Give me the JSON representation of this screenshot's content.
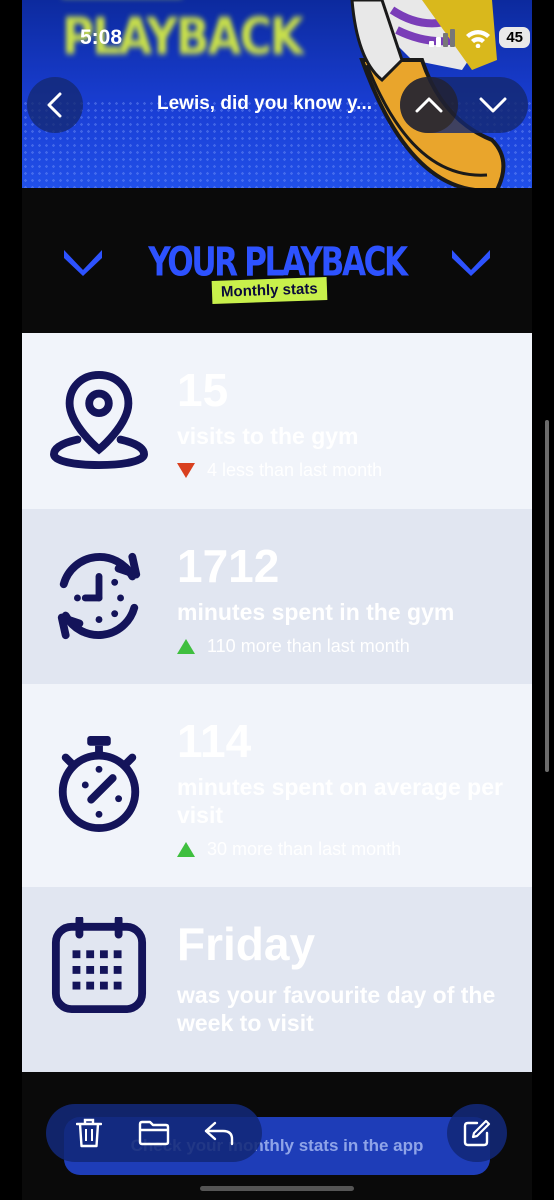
{
  "status_bar": {
    "time": "5:08",
    "battery": "45"
  },
  "nav": {
    "subject": "Lewis, did you know y..."
  },
  "hero": {
    "title": "PLAYBACK"
  },
  "playback": {
    "title": "YOUR PLAYBACK",
    "badge": "Monthly stats"
  },
  "stats": [
    {
      "value": "15",
      "label": "visits to the gym",
      "delta": "4 less than last month",
      "trend": "down",
      "icon": "location-pin-icon"
    },
    {
      "value": "1712",
      "label": "minutes spent in the gym",
      "delta": "110 more than last month",
      "trend": "up",
      "icon": "clock-refresh-icon"
    },
    {
      "value": "114",
      "label": "minutes spent on average per visit",
      "delta": "30 more than last month",
      "trend": "up",
      "icon": "stopwatch-icon"
    },
    {
      "value": "Friday",
      "label": "was your favourite day of the week to visit",
      "icon": "calendar-icon"
    }
  ],
  "cta": {
    "label": "Check your monthly stats in the app"
  },
  "colors": {
    "brand_blue": "#2d52ff",
    "accent_lime": "#c8f04b",
    "icon_navy": "#14145a",
    "down_red": "#d9401f",
    "up_green": "#3fbf3f"
  },
  "toolbar": {
    "icons": [
      "trash-icon",
      "folder-icon",
      "reply-icon",
      "compose-icon"
    ]
  }
}
